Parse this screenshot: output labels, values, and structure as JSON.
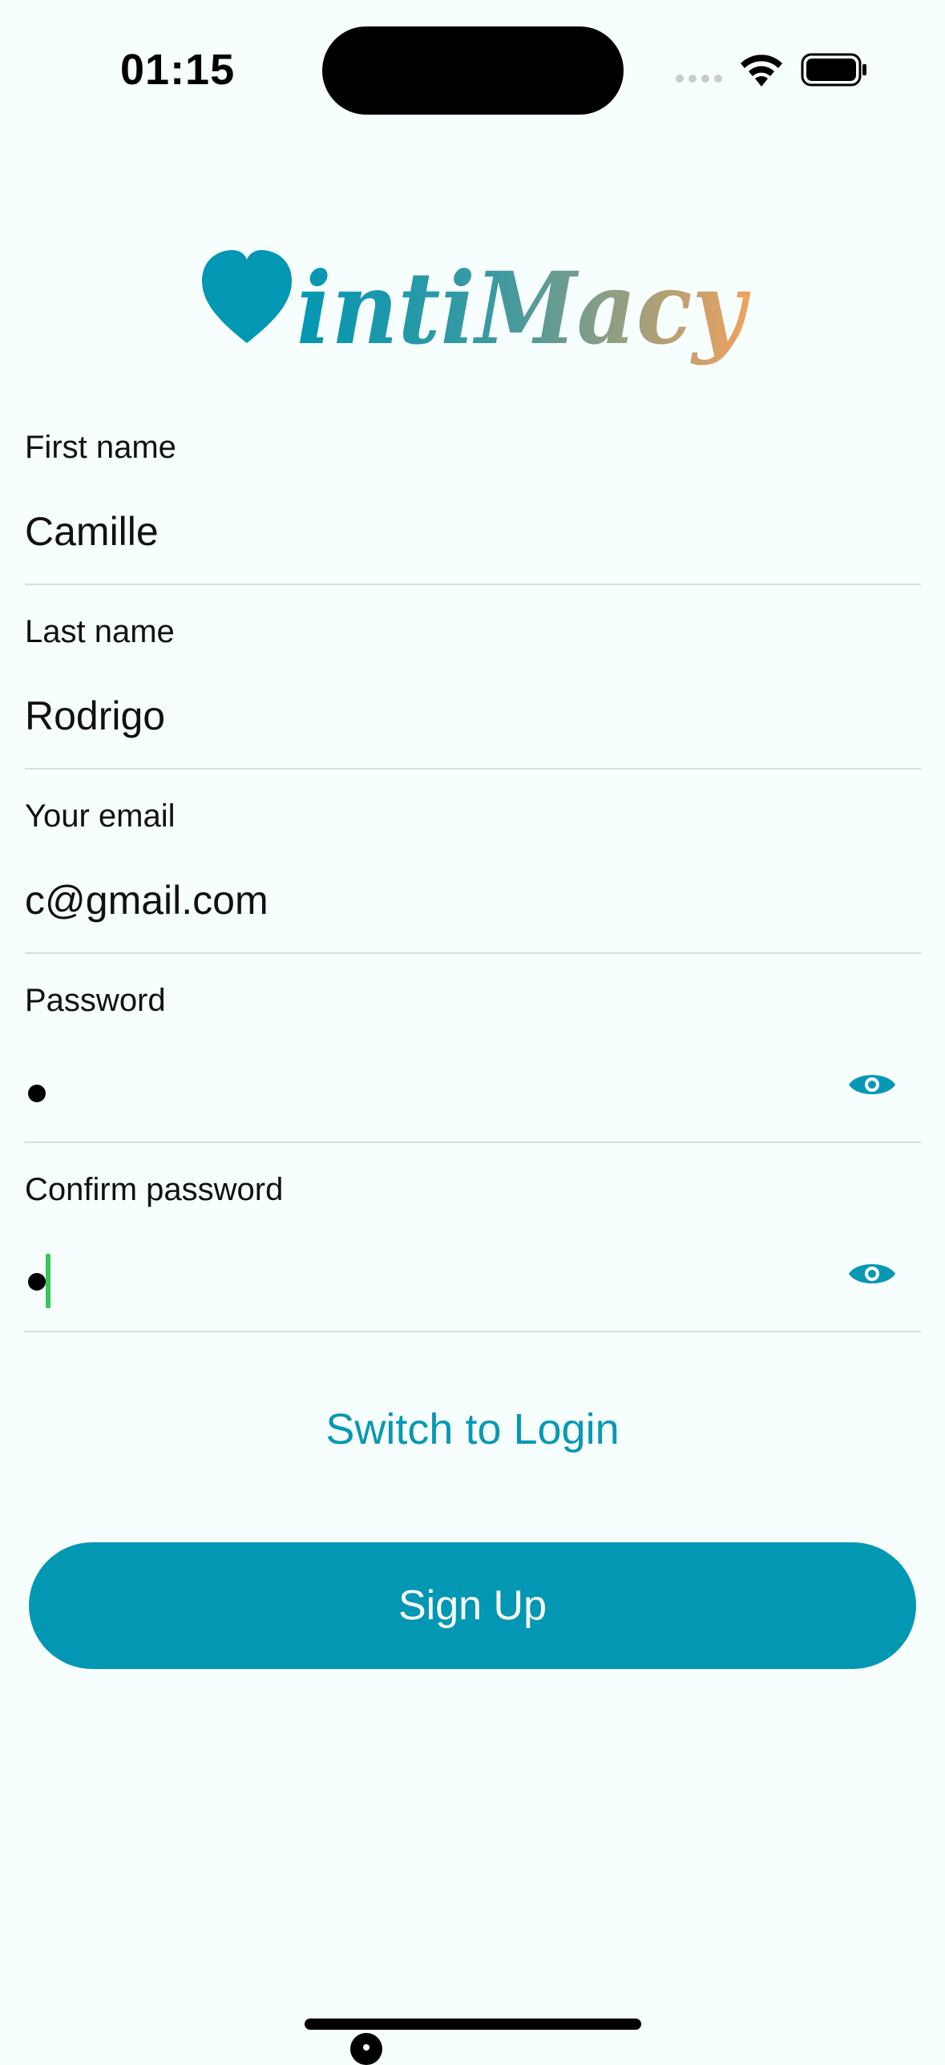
{
  "status_bar": {
    "time": "01:15"
  },
  "logo": {
    "text": "intiMacy",
    "icon": "heart-icon",
    "gradient_start": "#0297b3",
    "gradient_end": "#f2a25e"
  },
  "form": {
    "first_name": {
      "label": "First name",
      "value": "Camille"
    },
    "last_name": {
      "label": "Last name",
      "value": "Rodrigo"
    },
    "email": {
      "label": "Your email",
      "value": "c@gmail.com"
    },
    "password": {
      "label": "Password",
      "value": "•",
      "toggle_icon": "eye-icon"
    },
    "confirm_password": {
      "label": "Confirm password",
      "value": "•",
      "toggle_icon": "eye-icon"
    }
  },
  "actions": {
    "switch_label": "Switch to Login",
    "signup_label": "Sign Up"
  },
  "colors": {
    "accent": "#0297b3",
    "background": "#f7fefe",
    "divider": "#d9dede",
    "caret": "#35c759"
  }
}
